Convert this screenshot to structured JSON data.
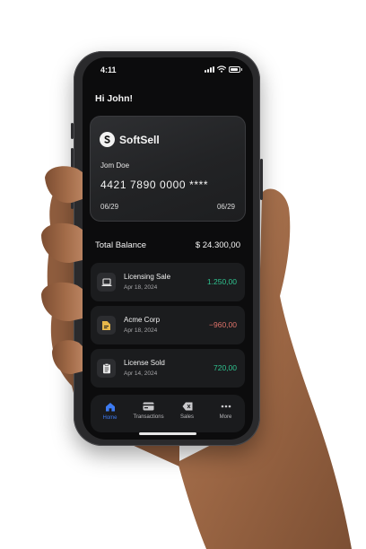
{
  "status_bar": {
    "time": "4:11"
  },
  "greeting": "Hi John!",
  "card": {
    "brand": "SoftSell",
    "holder": "Jom Doe",
    "number": "4421 7890 0000 ****",
    "expiry_left": "06/29",
    "expiry_right": "06/29"
  },
  "balance": {
    "label": "Total Balance",
    "value": "$ 24.300,00"
  },
  "transactions": [
    {
      "title": "Licensing Sale",
      "date": "Apr 18, 2024",
      "amount": "1.250,00",
      "icon": "laptop-icon",
      "type": "income"
    },
    {
      "title": "Acme Corp",
      "date": "Apr 18, 2024",
      "amount": "−960,00",
      "icon": "folder-icon",
      "type": "expense"
    },
    {
      "title": "License Sold",
      "date": "Apr 14, 2024",
      "amount": "720,00",
      "icon": "document-icon",
      "type": "income"
    }
  ],
  "tabs": [
    {
      "label": "Home",
      "icon": "home-icon",
      "active": true
    },
    {
      "label": "Transactions",
      "icon": "card-icon",
      "active": false
    },
    {
      "label": "Sales",
      "icon": "tag-icon",
      "active": false
    },
    {
      "label": "More",
      "icon": "more-icon",
      "active": false
    }
  ],
  "colors": {
    "income": "#2fc28f",
    "expense": "#e0736a",
    "accent": "#3d7bf2",
    "folder": "#e8b84a"
  }
}
